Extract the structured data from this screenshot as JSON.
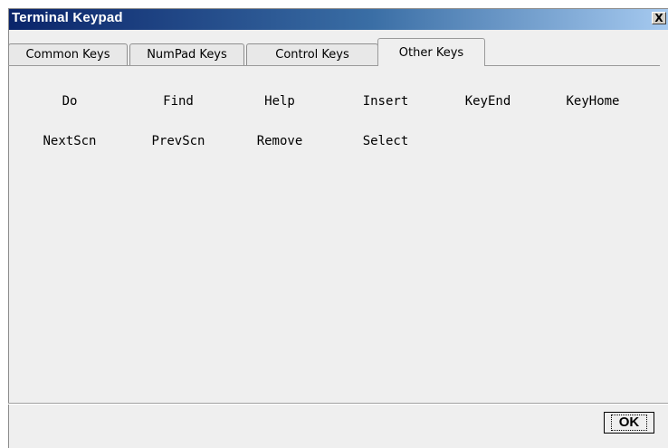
{
  "window": {
    "title": "Terminal Keypad",
    "close_label": "X"
  },
  "tabs": [
    {
      "label": "Common Keys",
      "active": false
    },
    {
      "label": "NumPad Keys",
      "active": false
    },
    {
      "label": "Control Keys",
      "active": false
    },
    {
      "label": "Other Keys",
      "active": true
    }
  ],
  "keys": {
    "row1": [
      "Do",
      "Find",
      "Help",
      "Insert",
      "KeyEnd",
      "KeyHome"
    ],
    "row2": [
      "NextScn",
      "PrevScn",
      "Remove",
      "Select"
    ]
  },
  "footer": {
    "ok_label": "OK"
  }
}
